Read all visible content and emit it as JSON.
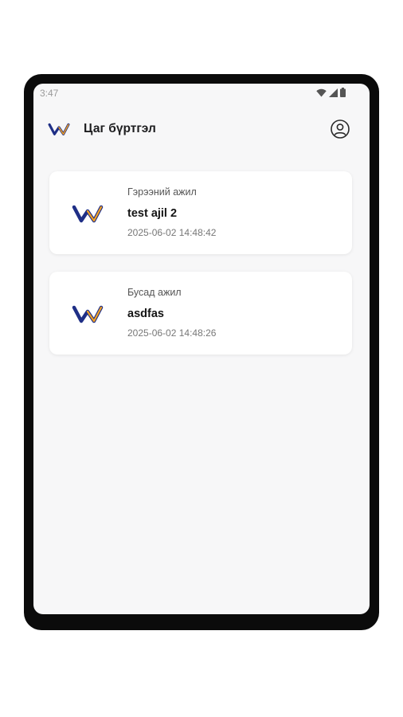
{
  "status_bar": {
    "time": "3:47",
    "icons": [
      "wifi-icon",
      "signal-icon",
      "battery-icon"
    ]
  },
  "app_bar": {
    "title": "Цаг бүртгэл",
    "logo": "app-logo",
    "profile_icon": "account-circle-icon"
  },
  "cards": [
    {
      "category": "Гэрээний ажил",
      "title": "test ajil 2",
      "date": "2025-06-02 14:48:42"
    },
    {
      "category": "Бусад ажил",
      "title": "asdfas",
      "date": "2025-06-02 14:48:26"
    }
  ],
  "colors": {
    "brand_navy": "#1f2f86",
    "brand_orange": "#f2a123",
    "screen_bg": "#f7f7f8",
    "device_frame": "#0b0b0b"
  }
}
